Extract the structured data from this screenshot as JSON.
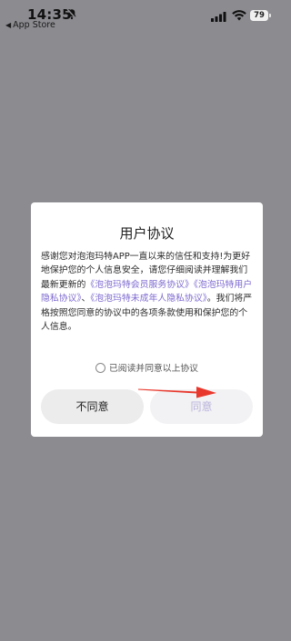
{
  "status_bar": {
    "time": "14:35",
    "back_label": "App Store",
    "battery": "79"
  },
  "dialog": {
    "title": "用户协议",
    "body_parts": [
      "感谢您对泡泡玛特APP一直以来的信任和支持!为更好地保护您的个人信息安全，请您仔细阅读并理解我们最新更新的",
      "《泡泡玛特会员服务协议》《泡泡玛特用户隐私协议》",
      "、",
      "《泡泡玛特未成年人隐私协议》",
      "。我们将严格按照您同意的协议中的各项条款使用和保护您的个人信息。"
    ],
    "consent_label": "已阅读并同意以上协议",
    "disagree_label": "不同意",
    "agree_label": "同意"
  },
  "colors": {
    "overlay": "#8c8b90",
    "link": "#7f6bd0",
    "agree_disabled_text": "#b9b3dc",
    "annotation_arrow": "#e8372c"
  }
}
